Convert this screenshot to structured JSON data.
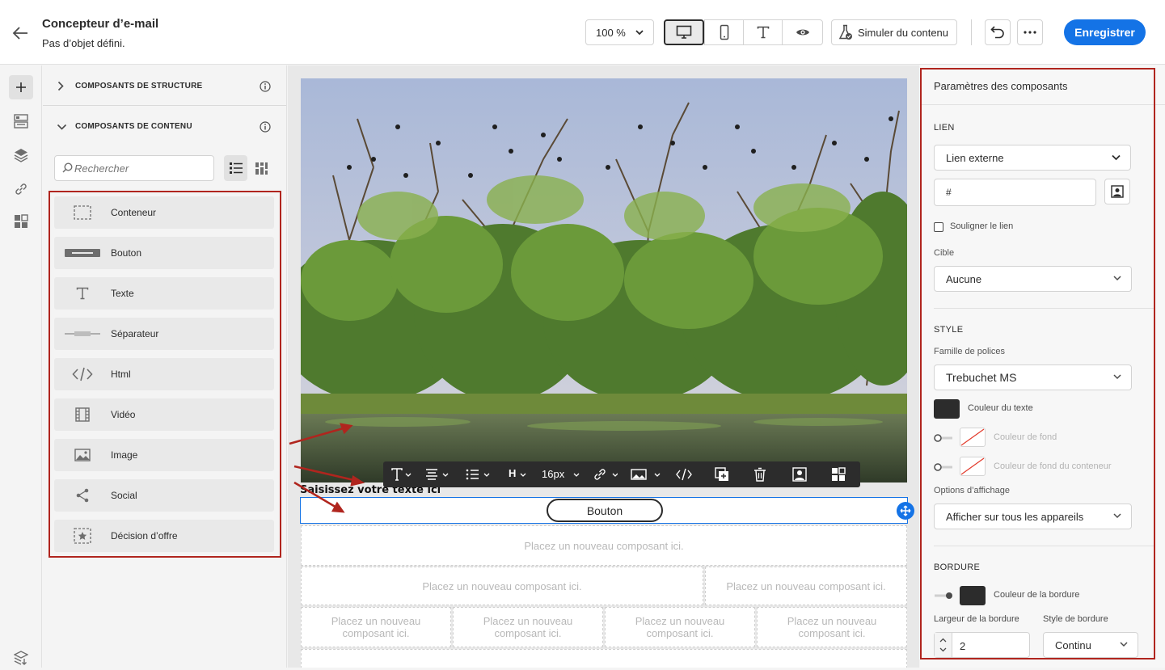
{
  "header": {
    "title": "Concepteur d’e-mail",
    "subtitle": "Pas d’objet défini.",
    "zoom": "100 %",
    "simulate_label": "Simuler du contenu",
    "save_label": "Enregistrer"
  },
  "components": {
    "structure_title": "COMPOSANTS DE STRUCTURE",
    "content_title": "COMPOSANTS DE CONTENU",
    "search_placeholder": "Rechercher",
    "items": [
      {
        "label": "Conteneur",
        "icon": "container-icon"
      },
      {
        "label": "Bouton",
        "icon": "button-icon"
      },
      {
        "label": "Texte",
        "icon": "text-icon"
      },
      {
        "label": "Séparateur",
        "icon": "divider-icon"
      },
      {
        "label": "Html",
        "icon": "code-icon"
      },
      {
        "label": "Vidéo",
        "icon": "video-icon"
      },
      {
        "label": "Image",
        "icon": "image-icon"
      },
      {
        "label": "Social",
        "icon": "share-icon"
      },
      {
        "label": "Décision d’offre",
        "icon": "offer-icon"
      }
    ]
  },
  "canvas": {
    "text_block": "Saisissez votre texte ici",
    "button_label": "Bouton",
    "font_size": "16px",
    "heading_label": "H",
    "placeholder_one": "Placez un nouveau composant ici.",
    "placeholder_multi": "Placez un nouveau composant ici."
  },
  "settings": {
    "title": "Paramètres des composants",
    "link_section": "LIEN",
    "link_type": "Lien externe",
    "link_url": "#",
    "underline_label": "Souligner le lien",
    "target_label": "Cible",
    "target_value": "Aucune",
    "style_section": "STYLE",
    "font_family_label": "Famille de polices",
    "font_family_value": "Trebuchet MS",
    "text_color_label": "Couleur du texte",
    "bg_color_label": "Couleur de fond",
    "container_bg_label": "Couleur de fond du conteneur",
    "display_options_label": "Options d’affichage",
    "display_options_value": "Afficher sur tous les appareils",
    "border_section": "BORDURE",
    "border_color_label": "Couleur de la bordure",
    "border_width_label": "Largeur de la bordure",
    "border_width_value": "2",
    "border_style_label": "Style de bordure",
    "border_style_value": "Continu"
  },
  "colors": {
    "accent": "#1473e6",
    "annotation_red": "#b0251e",
    "text_color_swatch": "#2c2c2c"
  }
}
